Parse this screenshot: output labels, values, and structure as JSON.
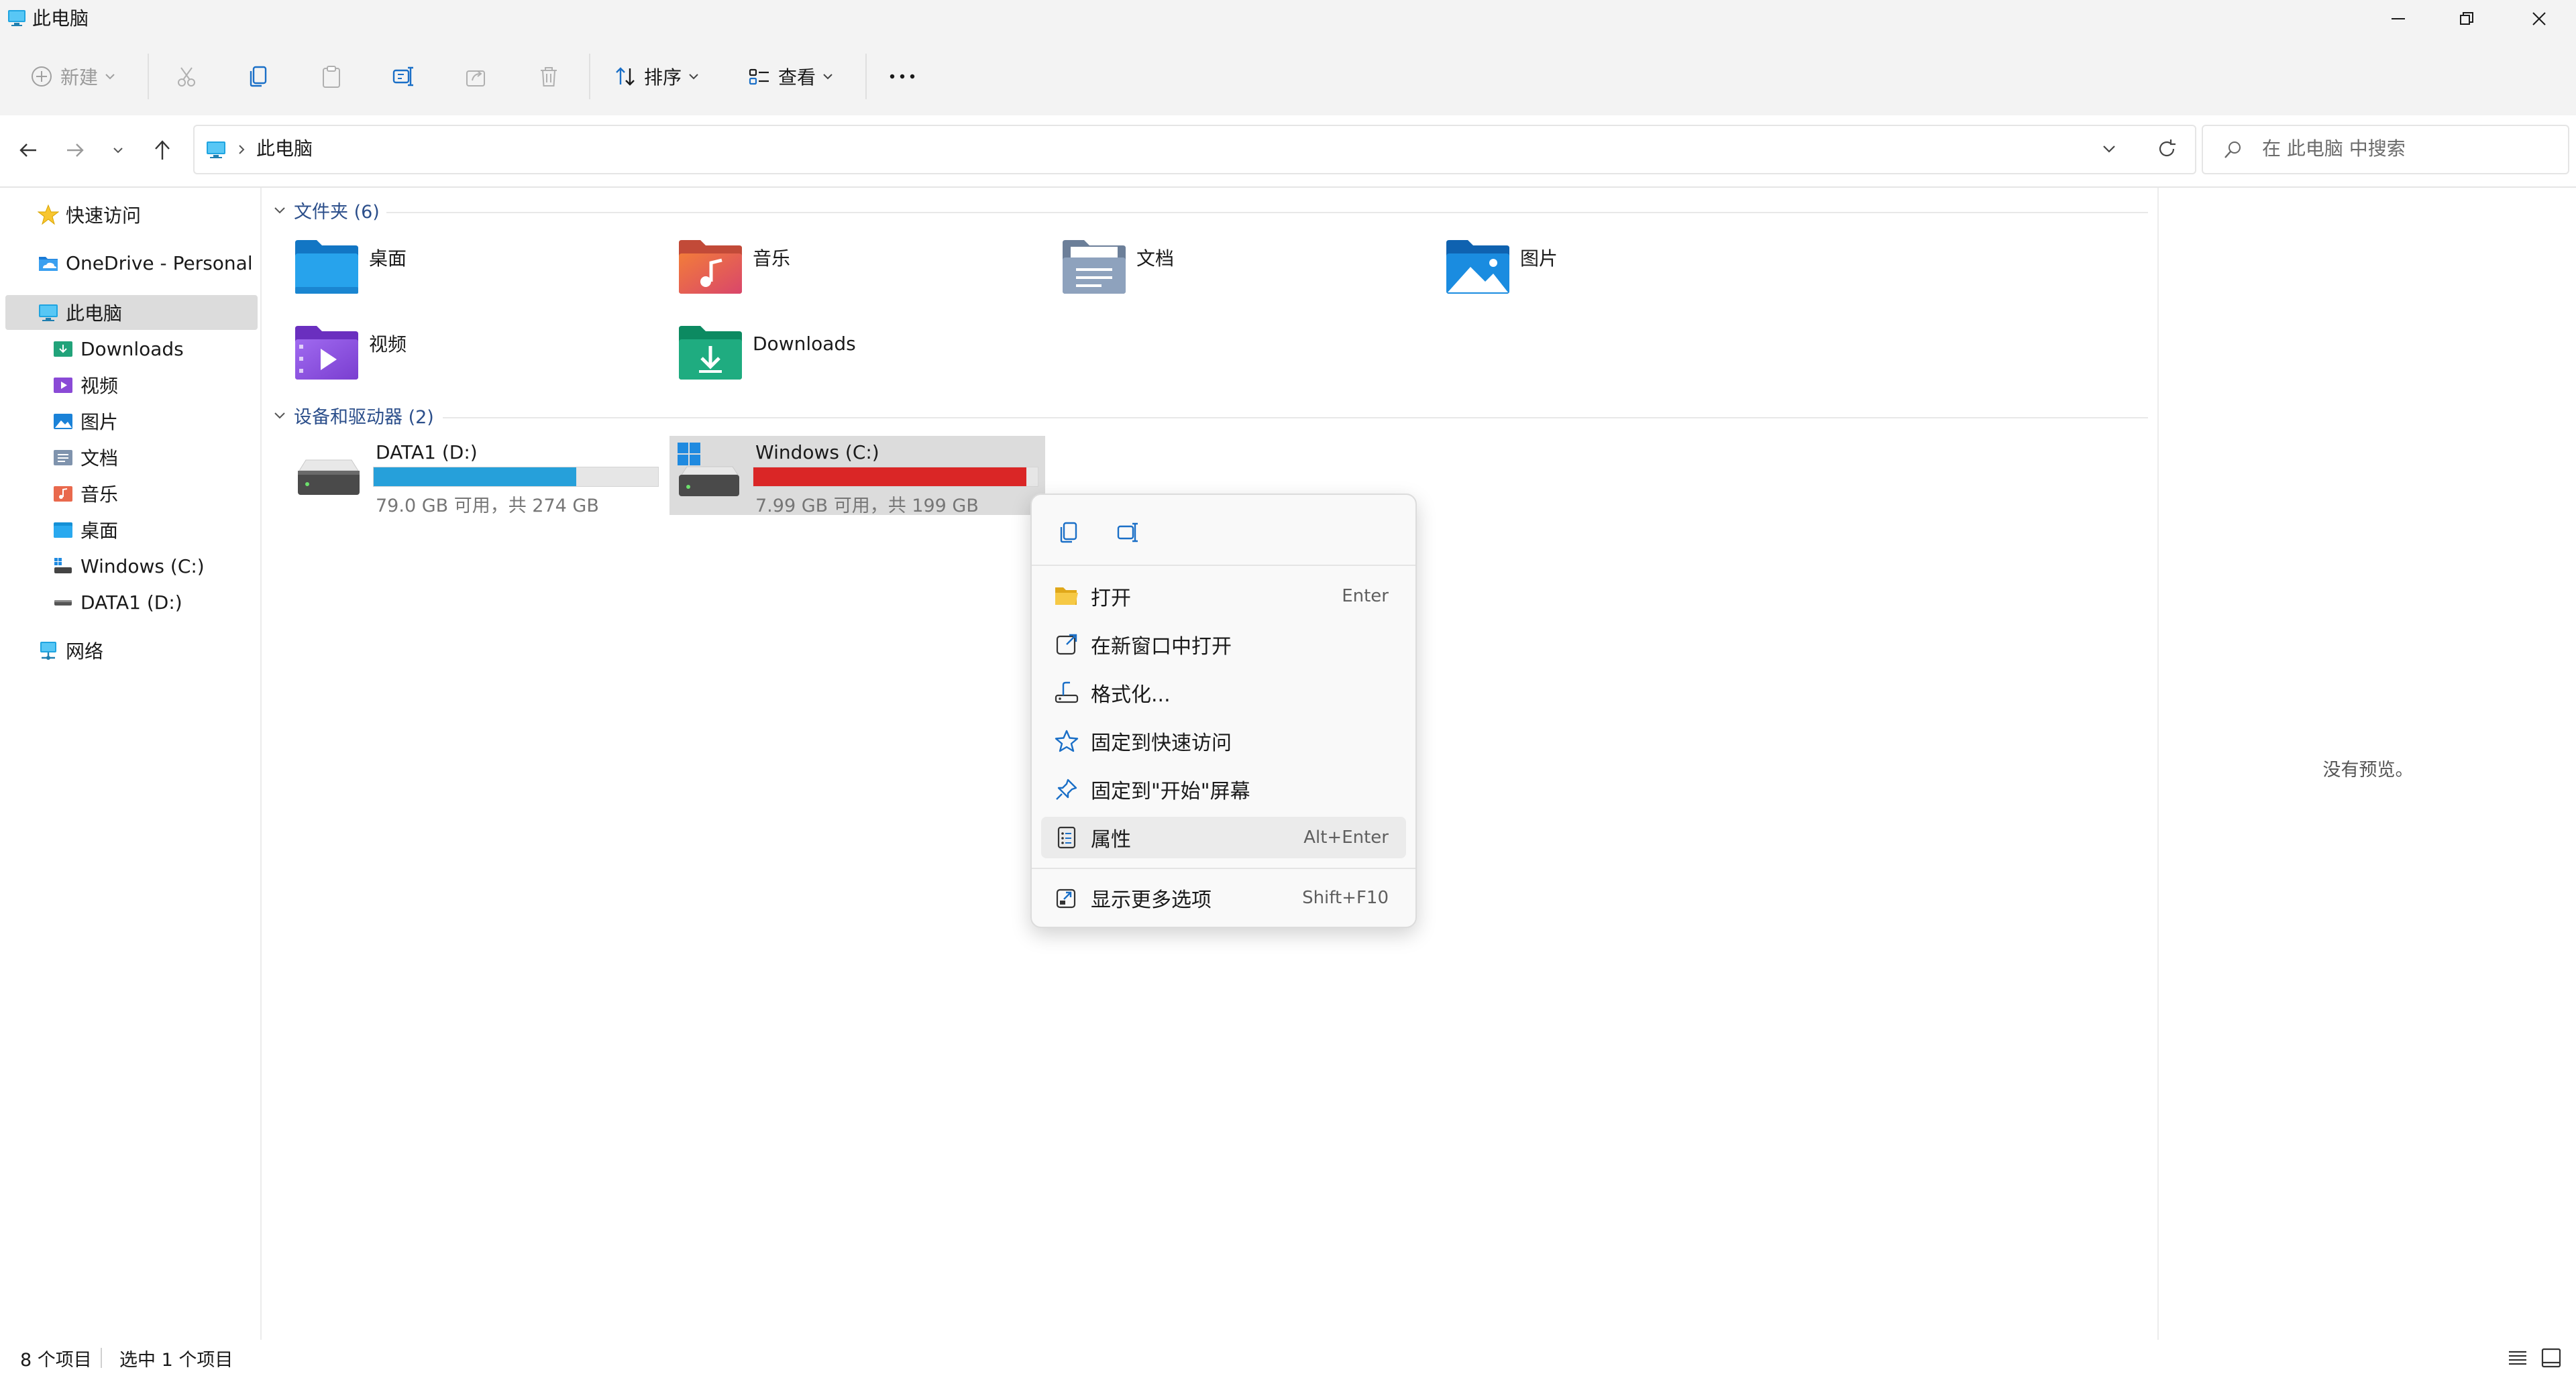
{
  "window": {
    "title": "此电脑"
  },
  "toolbar": {
    "new_label": "新建",
    "sort_label": "排序",
    "view_label": "查看"
  },
  "address": {
    "location": "此电脑"
  },
  "search": {
    "placeholder": "在 此电脑 中搜索"
  },
  "sidebar": {
    "quick_access": "快速访问",
    "onedrive": "OneDrive - Personal",
    "this_pc": "此电脑",
    "items": [
      "Downloads",
      "视频",
      "图片",
      "文档",
      "音乐",
      "桌面",
      "Windows (C:)",
      "DATA1 (D:)"
    ],
    "network": "网络"
  },
  "folders_section": {
    "title": "文件夹 (6)",
    "items": [
      "桌面",
      "音乐",
      "文档",
      "图片",
      "视频",
      "Downloads"
    ]
  },
  "drives_section": {
    "title": "设备和驱动器 (2)",
    "drives": [
      {
        "name": "DATA1 (D:)",
        "info": "79.0 GB 可用，共 274 GB",
        "used_fraction": 0.712,
        "bar_color": "#26a0da"
      },
      {
        "name": "Windows (C:)",
        "info": "7.99 GB 可用，共 199 GB",
        "used_fraction": 0.96,
        "bar_color": "#da2626"
      }
    ]
  },
  "context_menu": {
    "items": [
      {
        "label": "打开",
        "shortcut": "Enter"
      },
      {
        "label": "在新窗口中打开",
        "shortcut": ""
      },
      {
        "label": "格式化...",
        "shortcut": ""
      },
      {
        "label": "固定到快速访问",
        "shortcut": ""
      },
      {
        "label": "固定到\"开始\"屏幕",
        "shortcut": ""
      },
      {
        "label": "属性",
        "shortcut": "Alt+Enter"
      },
      {
        "label": "显示更多选项",
        "shortcut": "Shift+F10"
      }
    ]
  },
  "preview": {
    "empty_text": "没有预览。"
  },
  "status": {
    "item_count": "8 个项目",
    "selected_count": "选中 1 个项目"
  },
  "colors": {
    "accent": "#0067c0",
    "selection": "#cce8ff",
    "drive_used_normal": "#26a0da",
    "drive_used_full": "#da2626"
  }
}
